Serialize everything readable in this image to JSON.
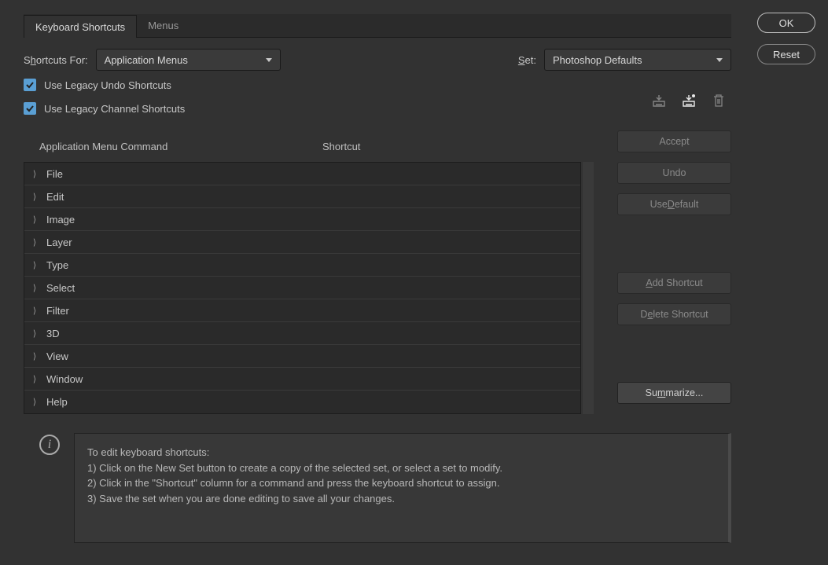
{
  "tabs": {
    "shortcuts": "Keyboard Shortcuts",
    "menus": "Menus"
  },
  "controls": {
    "shortcuts_for_pre": "S",
    "shortcuts_for_u": "h",
    "shortcuts_for_post": "ortcuts For:",
    "shortcuts_for_value": "Application Menus",
    "set_pre": "",
    "set_u": "S",
    "set_post": "et:",
    "set_value": "Photoshop Defaults",
    "legacy_undo": "Use Legacy Undo Shortcuts",
    "legacy_channel": "Use Legacy Channel Shortcuts"
  },
  "columns": {
    "command": "Application Menu Command",
    "shortcut": "Shortcut"
  },
  "tree": [
    "File",
    "Edit",
    "Image",
    "Layer",
    "Type",
    "Select",
    "Filter",
    "3D",
    "View",
    "Window",
    "Help"
  ],
  "buttons": {
    "accept": "Accept",
    "undo": "Undo",
    "use_default_pre": "Use ",
    "use_default_u": "D",
    "use_default_post": "efault",
    "add_pre": "",
    "add_u": "A",
    "add_post": "dd Shortcut",
    "delete_pre": "D",
    "delete_u": "e",
    "delete_post": "lete Shortcut",
    "summarize_pre": "Su",
    "summarize_u": "m",
    "summarize_post": "marize...",
    "ok": "OK",
    "reset": "Reset"
  },
  "info": {
    "line0": "To edit keyboard shortcuts:",
    "line1": "1) Click on the New Set button to create a copy of the selected set, or select a set to modify.",
    "line2": "2) Click in the \"Shortcut\" column for a command and press the keyboard shortcut to assign.",
    "line3": "3) Save the set when you are done editing to save all your changes."
  }
}
